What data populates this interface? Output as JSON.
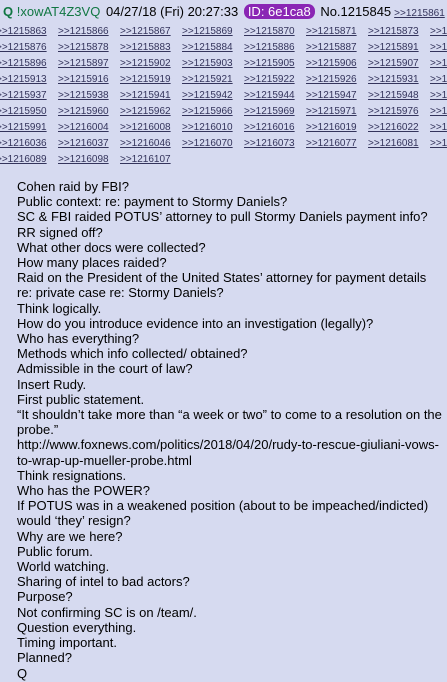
{
  "post": {
    "name": "Q",
    "tripcode": "!xowAT4Z3VQ",
    "date": "04/27/18 (Fri) 20:27:33",
    "id_label": "ID: 6e1ca8",
    "post_no_label": "No.1215845",
    "id_color": "#8a26b4",
    "name_color": "#117743",
    "link_color": "#34345c",
    "background_color": "#d6daf0"
  },
  "backlinks": [
    ">>1215861",
    ">>1215863",
    ">>1215866",
    ">>1215867",
    ">>1215869",
    ">>1215870",
    ">>1215871",
    ">>1215873",
    ">>1215874",
    ">>1215876",
    ">>1215878",
    ">>1215883",
    ">>1215884",
    ">>1215886",
    ">>1215887",
    ">>1215891",
    ">>1215892",
    ">>1215896",
    ">>1215897",
    ">>1215902",
    ">>1215903",
    ">>1215905",
    ">>1215906",
    ">>1215907",
    ">>1215910",
    ">>1215913",
    ">>1215916",
    ">>1215919",
    ">>1215921",
    ">>1215922",
    ">>1215926",
    ">>1215931",
    ">>1215935",
    ">>1215937",
    ">>1215938",
    ">>1215941",
    ">>1215942",
    ">>1215944",
    ">>1215947",
    ">>1215948",
    ">>1215949",
    ">>1215950",
    ">>1215960",
    ">>1215962",
    ">>1215966",
    ">>1215969",
    ">>1215971",
    ">>1215976",
    ">>1215985",
    ">>1215991",
    ">>1216004",
    ">>1216008",
    ">>1216010",
    ">>1216016",
    ">>1216019",
    ">>1216022",
    ">>1216026",
    ">>1216036",
    ">>1216037",
    ">>1216046",
    ">>1216070",
    ">>1216073",
    ">>1216077",
    ">>1216081",
    ">>1216087",
    ">>1216089",
    ">>1216098",
    ">>1216107"
  ],
  "message": [
    "Cohen raid by FBI?",
    "Public context: re: payment to Stormy Daniels?",
    "SC & FBI raided POTUS’ attorney to pull Stormy Daniels payment info?",
    "RR signed off?",
    "What other docs were collected?",
    "How many places raided?",
    "Raid on the President of the United States’ attorney for payment details re: private case re: Stormy Daniels?",
    "Think logically.",
    "How do you introduce evidence into an investigation (legally)?",
    "Who has everything?",
    "Methods which info collected/ obtained?",
    "Admissible in the court of law?",
    "Insert Rudy.",
    "First public statement.",
    "“It shouldn’t take more than “a week or two” to come to a resolution on the probe.”",
    "http://www.foxnews.com/politics/2018/04/20/rudy-to-rescue-giuliani-vows-to-wrap-up-mueller-probe.html",
    "Think resignations.",
    "Who has the POWER?",
    "If POTUS was in a weakened position (about to be impeached/indicted) would ‘they’ resign?",
    "Why are we here?",
    "Public forum.",
    "World watching.",
    "Sharing of intel to bad actors?",
    "Purpose?",
    "Not confirming SC is on /team/.",
    "Question everything.",
    "Timing important.",
    "Planned?",
    "Q"
  ]
}
